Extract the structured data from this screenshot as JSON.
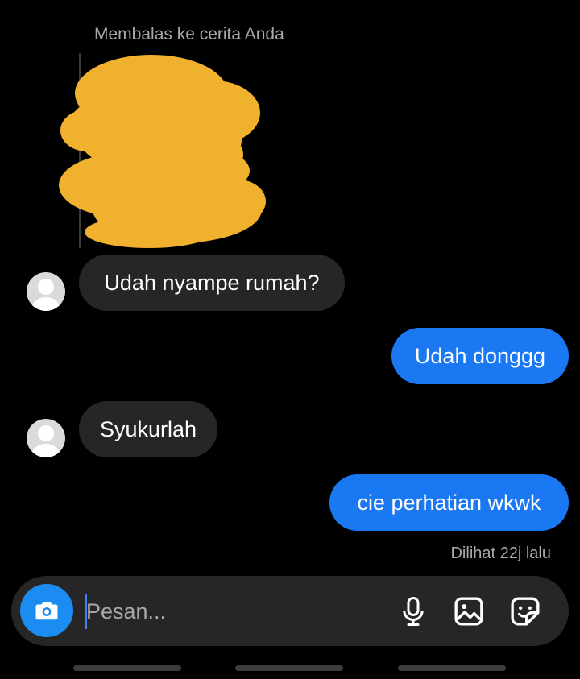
{
  "reply_label": "Membalas ke cerita Anda",
  "messages": [
    {
      "text": "Udah nyampe rumah?",
      "from": "them"
    },
    {
      "text": "Udah donggg",
      "from": "me"
    },
    {
      "text": "Syukurlah",
      "from": "them"
    },
    {
      "text": "cie perhatian wkwk",
      "from": "me"
    }
  ],
  "seen_status": "Dilihat 22j lalu",
  "composer": {
    "placeholder": "Pesan...",
    "icons": [
      "camera-icon",
      "microphone-icon",
      "gallery-icon",
      "sticker-icon"
    ]
  },
  "colors": {
    "background": "#000000",
    "incoming_bubble": "#262626",
    "outgoing_bubble": "#1a78f2",
    "camera_button": "#1a8cf2",
    "story_redaction": "#f0b12f"
  }
}
